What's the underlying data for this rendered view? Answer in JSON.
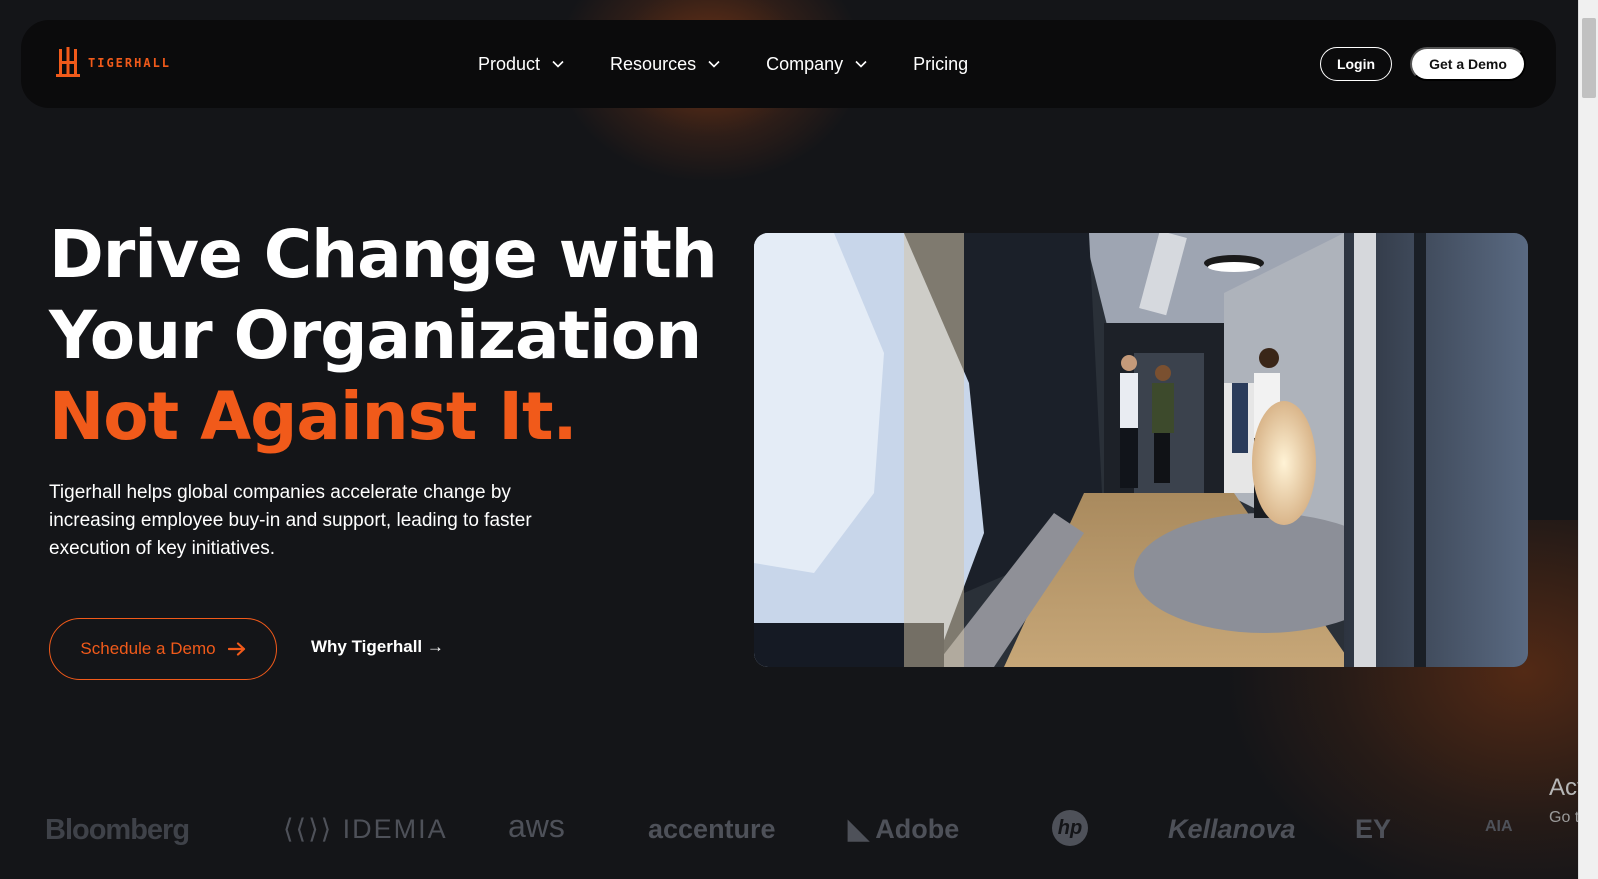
{
  "brand": {
    "name": "TIGERHALL",
    "accent_color": "#f15a1a"
  },
  "nav": {
    "items": [
      {
        "label": "Product",
        "has_dropdown": true
      },
      {
        "label": "Resources",
        "has_dropdown": true
      },
      {
        "label": "Company",
        "has_dropdown": true
      },
      {
        "label": "Pricing",
        "has_dropdown": false
      }
    ],
    "login_label": "Login",
    "demo_label": "Get a Demo"
  },
  "hero": {
    "headline_line1": "Drive Change with",
    "headline_line2": "Your Organization",
    "headline_accent": "Not Against It.",
    "description": "Tigerhall helps global companies accelerate change by increasing employee buy-in and support, leading to faster execution of key initiatives.",
    "primary_cta": "Schedule a Demo",
    "secondary_cta": "Why Tigerhall →"
  },
  "video": {
    "icon": "office-hallway-video"
  },
  "client_logos": [
    "Bloomberg",
    "IDEMIA",
    "aws",
    "accenture",
    "Adobe",
    "hp",
    "Kellanova",
    "EY",
    "AIA"
  ],
  "os_overlay": {
    "line1": "Activ",
    "line2": "Go to"
  }
}
